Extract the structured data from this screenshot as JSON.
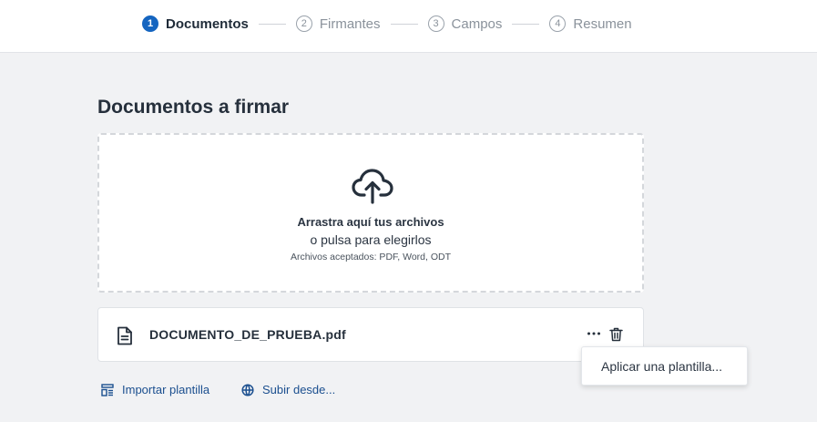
{
  "stepper": {
    "steps": [
      {
        "number": "1",
        "label": "Documentos",
        "active": true
      },
      {
        "number": "2",
        "label": "Firmantes",
        "active": false
      },
      {
        "number": "3",
        "label": "Campos",
        "active": false
      },
      {
        "number": "4",
        "label": "Resumen",
        "active": false
      }
    ]
  },
  "page": {
    "title": "Documentos a firmar"
  },
  "dropzone": {
    "icon": "cloud-upload-icon",
    "primary_text": "Arrastra aquí tus archivos",
    "secondary_text": "o pulsa para elegirlos",
    "hint": "Archivos aceptados: PDF, Word, ODT"
  },
  "document": {
    "icon": "file-text-icon",
    "name": "DOCUMENTO_DE_PRUEBA.pdf"
  },
  "context_menu": {
    "items": [
      "Aplicar una plantilla..."
    ]
  },
  "actions": {
    "import_template": "Importar plantilla",
    "upload_from": "Subir desde..."
  },
  "colors": {
    "accent": "#1565c0",
    "link": "#1b4f8f",
    "background": "#f1f2f4",
    "text": "#2b3542"
  }
}
